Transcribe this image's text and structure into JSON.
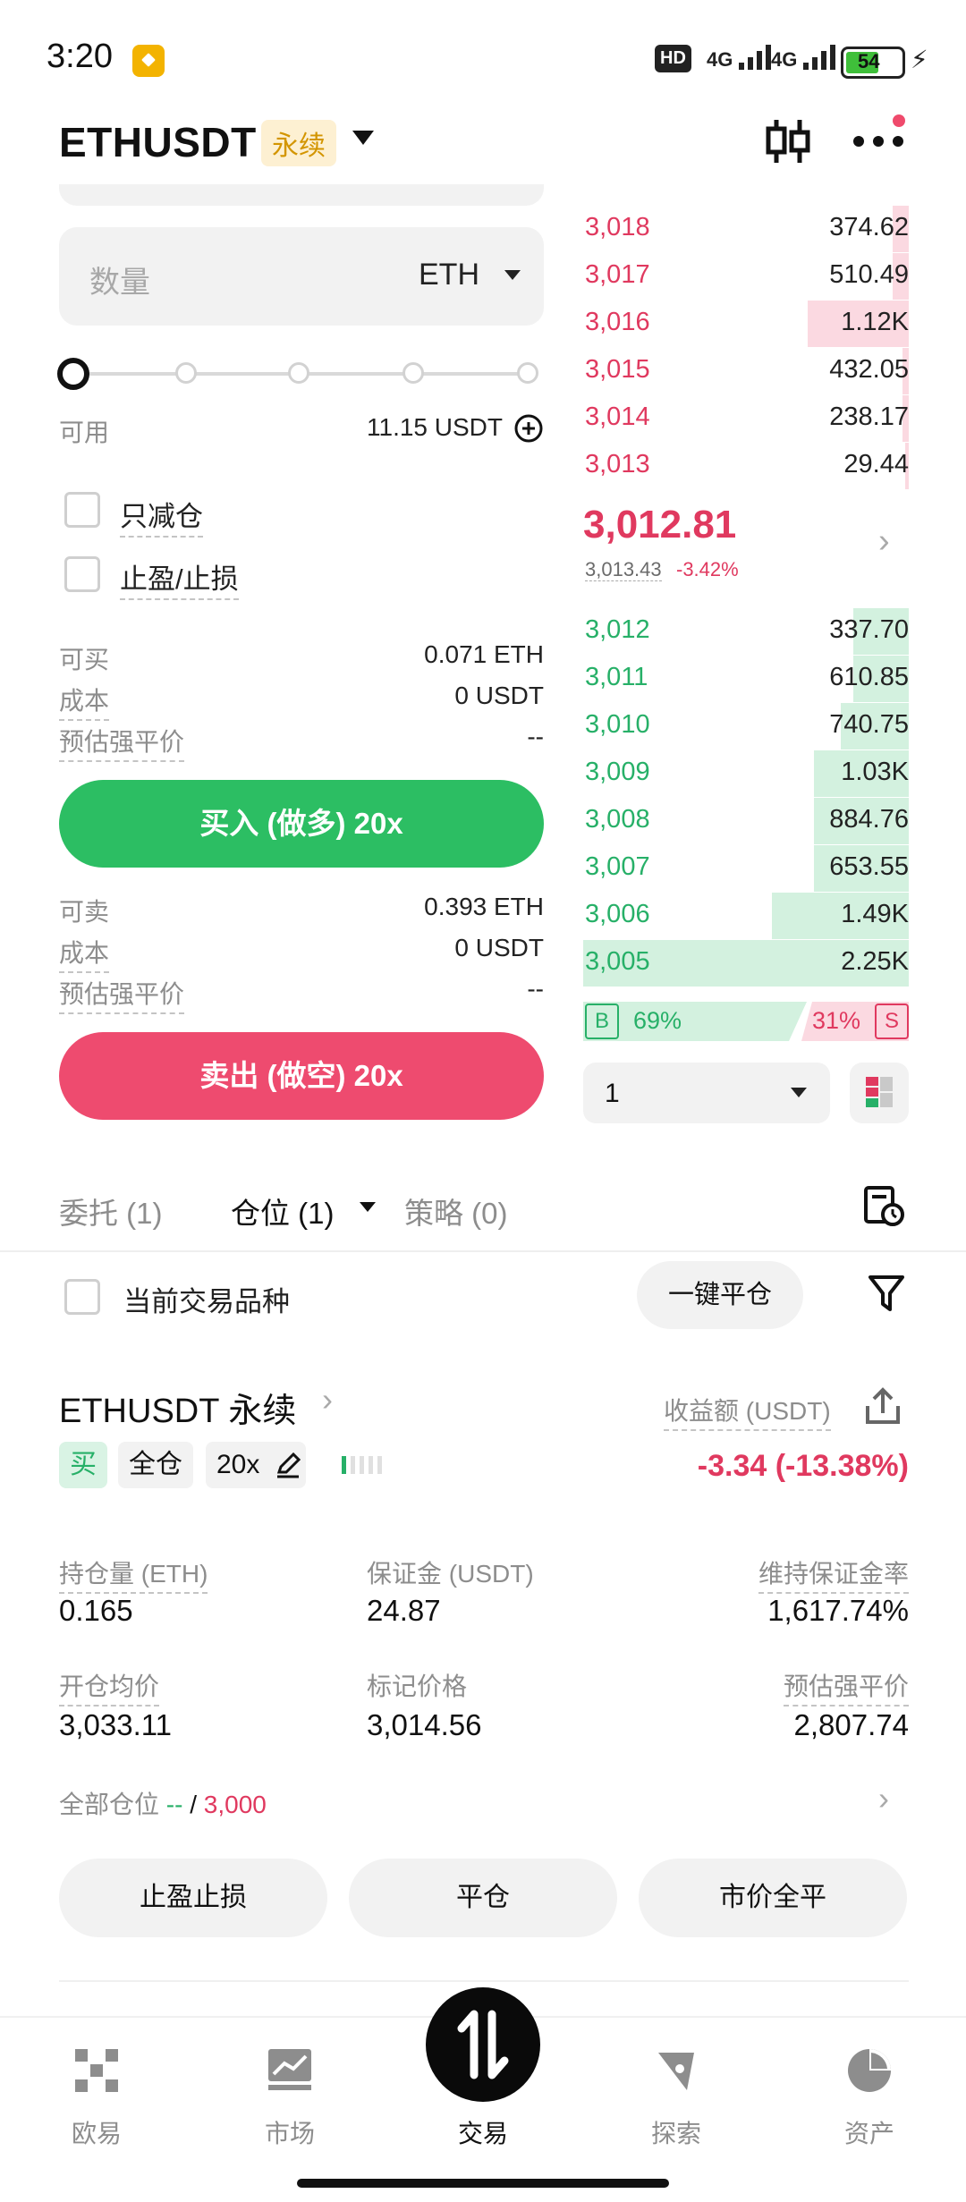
{
  "status_bar": {
    "time": "3:20",
    "hd": "HD",
    "net1": "4G",
    "net2": "4G",
    "battery": "54"
  },
  "header": {
    "pair": "ETHUSDT",
    "badge": "永续"
  },
  "order_form": {
    "qty_placeholder": "数量",
    "qty_unit": "ETH",
    "available_label": "可用",
    "available_value": "11.15 USDT",
    "leverage_progress": 0,
    "reduce_only_label": "只减仓",
    "tpsl_label": "止盈/止损",
    "buy_block": {
      "max_label": "可买",
      "max_value": "0.071 ETH",
      "cost_label": "成本",
      "cost_value": "0 USDT",
      "liq_label": "预估强平价",
      "liq_value": "--",
      "button": "买入 (做多) 20x"
    },
    "sell_block": {
      "max_label": "可卖",
      "max_value": "0.393 ETH",
      "cost_label": "成本",
      "cost_value": "0 USDT",
      "liq_label": "预估强平价",
      "liq_value": "--",
      "button": "卖出 (做空) 20x"
    }
  },
  "order_book": {
    "asks": [
      {
        "price": "3,018",
        "size": "374.62",
        "depth": 0.05
      },
      {
        "price": "3,017",
        "size": "510.49",
        "depth": 0.05
      },
      {
        "price": "3,016",
        "size": "1.12K",
        "depth": 0.31
      },
      {
        "price": "3,015",
        "size": "432.05",
        "depth": 0.02
      },
      {
        "price": "3,014",
        "size": "238.17",
        "depth": 0.02
      },
      {
        "price": "3,013",
        "size": "29.44",
        "depth": 0.01
      }
    ],
    "last_price": "3,012.81",
    "mark_price": "3,013.43",
    "change": "-3.42%",
    "bids": [
      {
        "price": "3,012",
        "size": "337.70",
        "depth": 0.17
      },
      {
        "price": "3,011",
        "size": "610.85",
        "depth": 0.17
      },
      {
        "price": "3,010",
        "size": "740.75",
        "depth": 0.21
      },
      {
        "price": "3,009",
        "size": "1.03K",
        "depth": 0.29
      },
      {
        "price": "3,008",
        "size": "884.76",
        "depth": 0.29
      },
      {
        "price": "3,007",
        "size": "653.55",
        "depth": 0.29
      },
      {
        "price": "3,006",
        "size": "1.49K",
        "depth": 0.42
      },
      {
        "price": "3,005",
        "size": "2.25K",
        "depth": 1.0
      }
    ],
    "buy_ratio_tag": "B",
    "buy_ratio": "69%",
    "sell_ratio": "31%",
    "sell_ratio_tag": "S",
    "depth_step": "1"
  },
  "tabs": {
    "orders": "委托 (1)",
    "positions": "仓位 (1)",
    "strategies": "策略 (0)"
  },
  "positions_filter": {
    "current_symbol_label": "当前交易品种",
    "close_all_button": "一键平仓"
  },
  "position": {
    "title": "ETHUSDT 永续",
    "side_tag": "买",
    "margin_mode": "全仓",
    "leverage": "20x",
    "pnl_label": "收益额 (USDT)",
    "pnl_value": "-3.34 (-13.38%)",
    "size_label": "持仓量 (ETH)",
    "size_value": "0.165",
    "margin_label": "保证金 (USDT)",
    "margin_value": "24.87",
    "mmr_label": "维持保证金率",
    "mmr_value": "1,617.74%",
    "entry_label": "开仓均价",
    "entry_value": "3,033.11",
    "markp_label": "标记价格",
    "markp_value": "3,014.56",
    "liq_label": "预估强平价",
    "liq_value": "2,807.74",
    "all_positions_label": "全部仓位",
    "all_positions_a": "--",
    "all_positions_sep": "/",
    "all_positions_b": "3,000",
    "btn_tpsl": "止盈止损",
    "btn_close": "平仓",
    "btn_market_close": "市价全平"
  },
  "bottom_nav": {
    "items": [
      "欧易",
      "市场",
      "交易",
      "探索",
      "资产"
    ]
  },
  "colors": {
    "buy_green": "#2cbe63",
    "sell_red": "#ee4b6f",
    "badge_gold": "#d39500"
  }
}
